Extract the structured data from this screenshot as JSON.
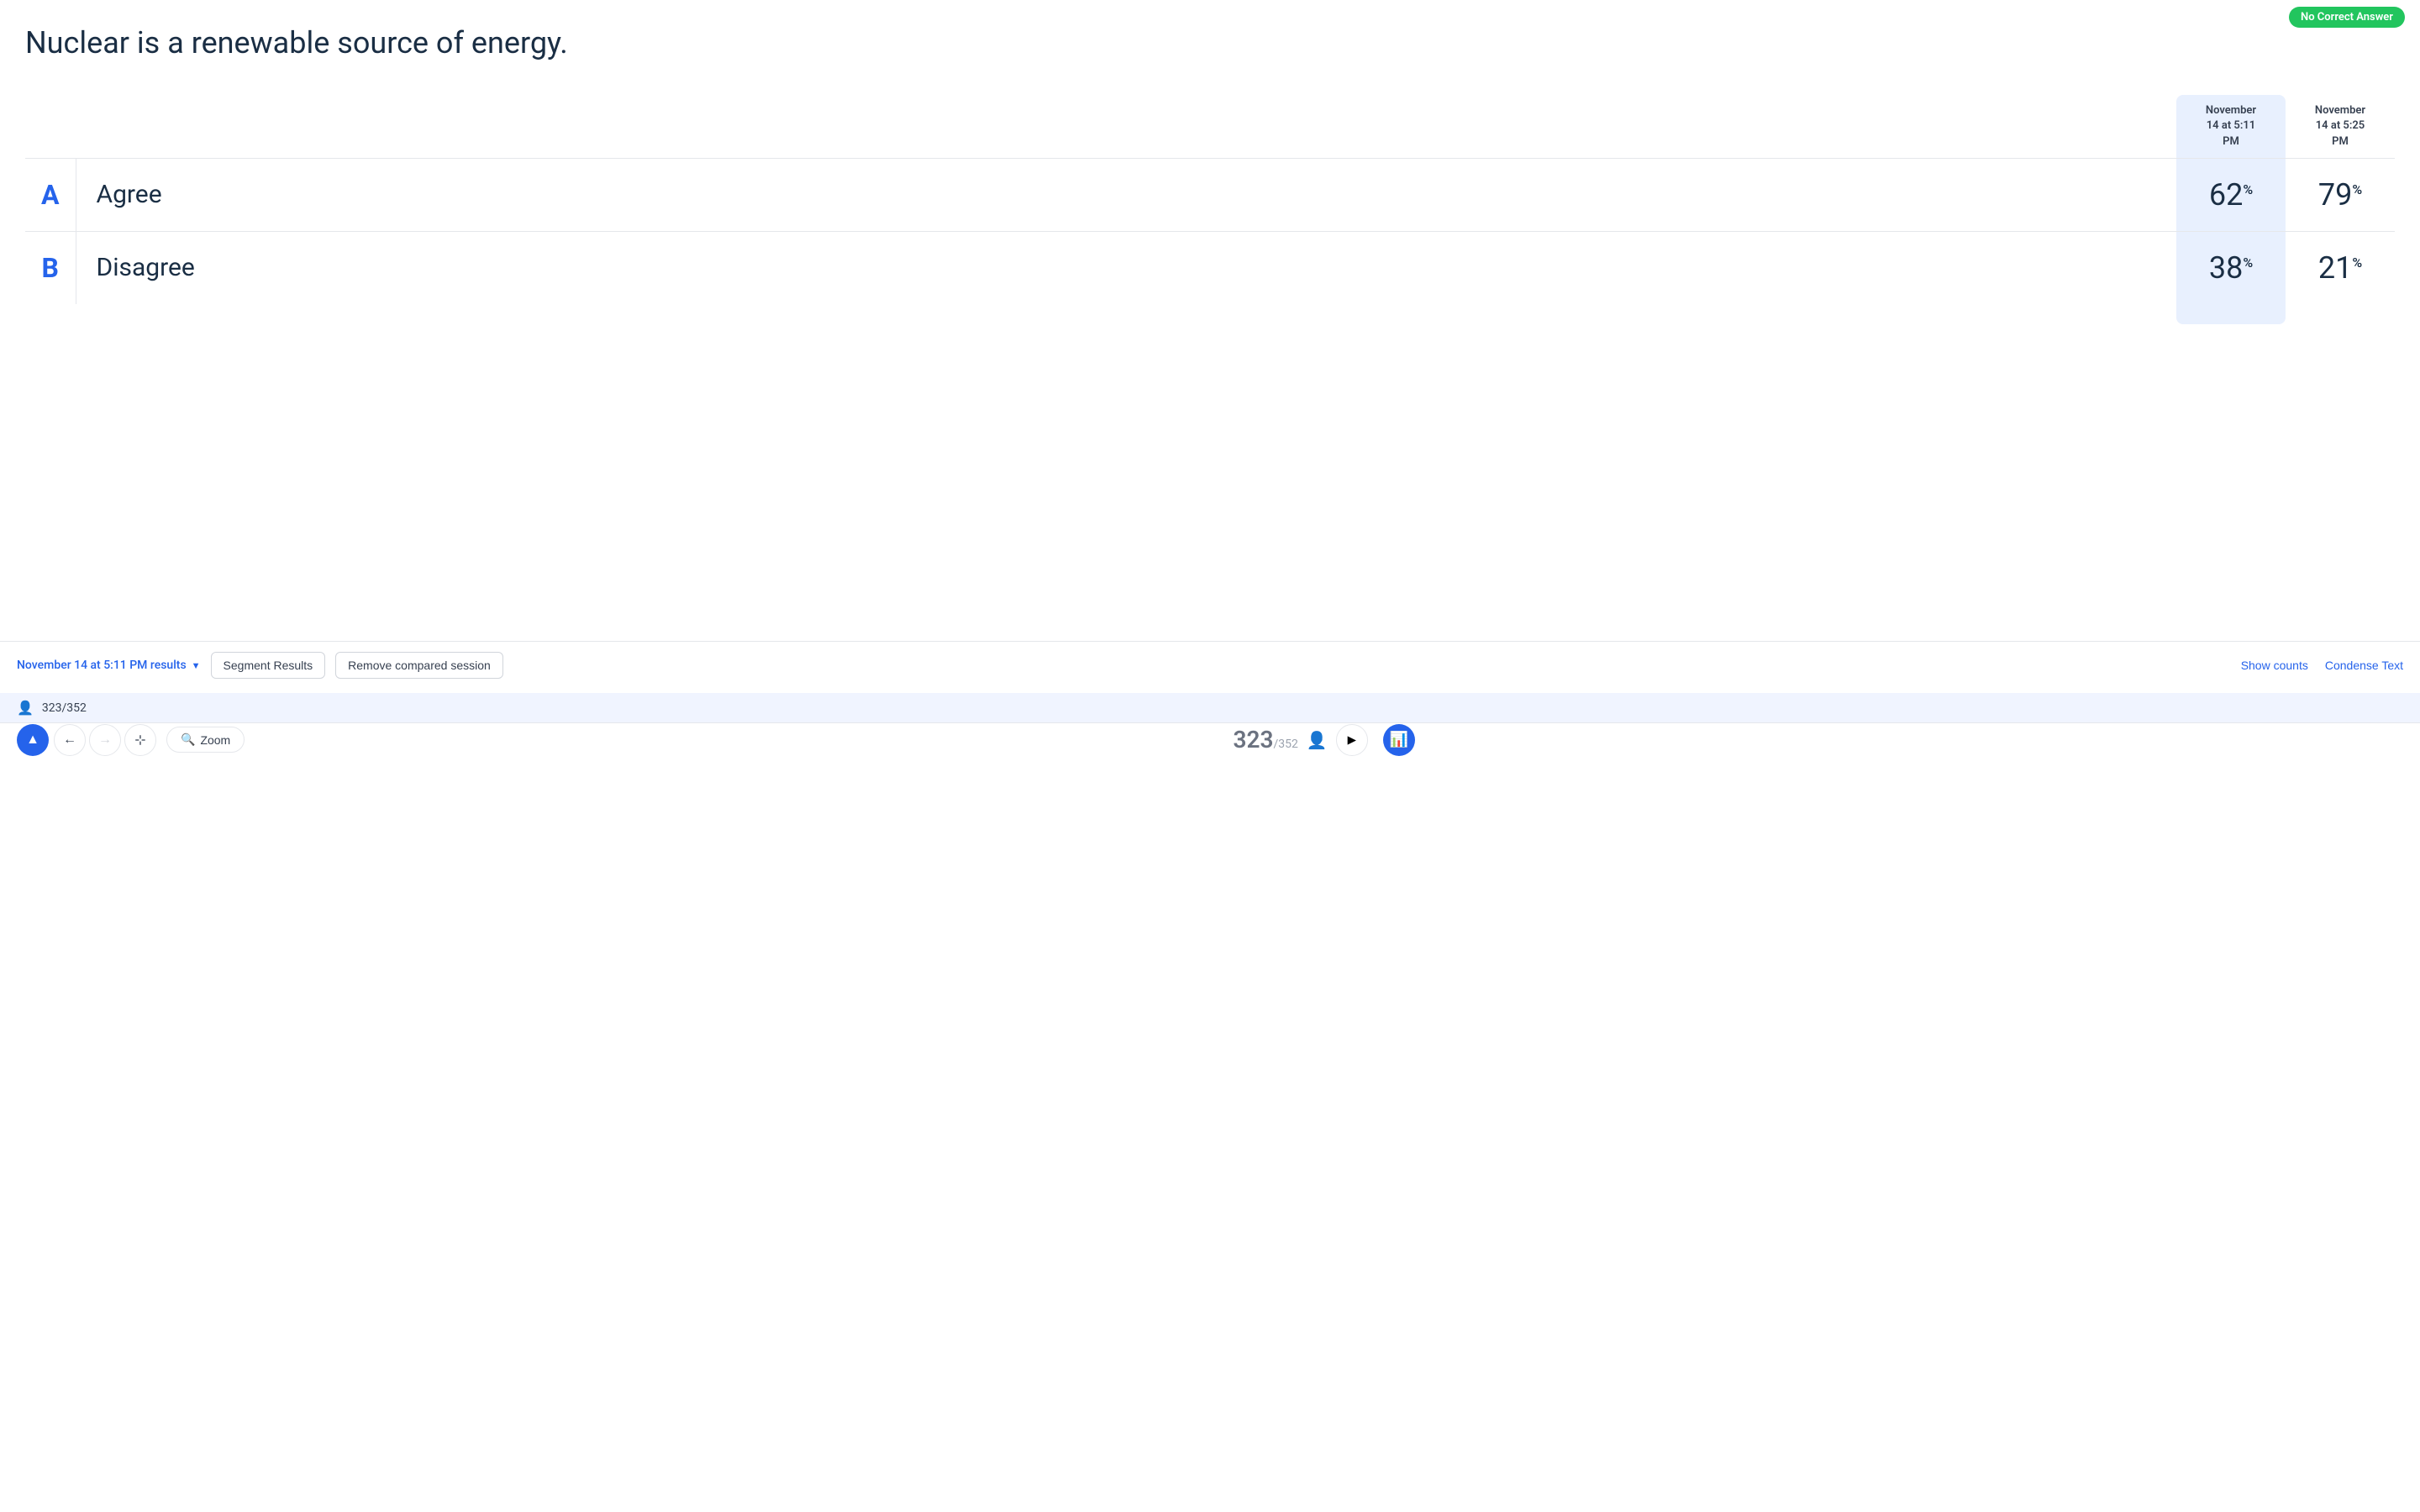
{
  "badge": {
    "label": "No Correct Answer",
    "color": "#22c55e"
  },
  "question": {
    "text": "Nuclear is a renewable source of energy."
  },
  "sessions": {
    "session1": {
      "label": "November\n14 at 5:11\nPM",
      "line1": "November",
      "line2": "14 at 5:11",
      "line3": "PM"
    },
    "session2": {
      "label": "November\n14 at 5:25\nPM",
      "line1": "November",
      "line2": "14 at 5:25",
      "line3": "PM"
    }
  },
  "answers": [
    {
      "letter": "A",
      "text": "Agree",
      "session1_pct": "62",
      "session2_pct": "79"
    },
    {
      "letter": "B",
      "text": "Disagree",
      "session1_pct": "38",
      "session2_pct": "21"
    }
  ],
  "toolbar": {
    "session_selector_label": "November 14 at 5:11 PM results",
    "segment_btn": "Segment Results",
    "remove_btn": "Remove compared session",
    "show_counts_btn": "Show counts",
    "condense_text_btn": "Condense Text"
  },
  "stats": {
    "count": "323/352"
  },
  "nav": {
    "slide_main": "323",
    "slide_sub": "/352",
    "zoom_label": "Zoom"
  }
}
